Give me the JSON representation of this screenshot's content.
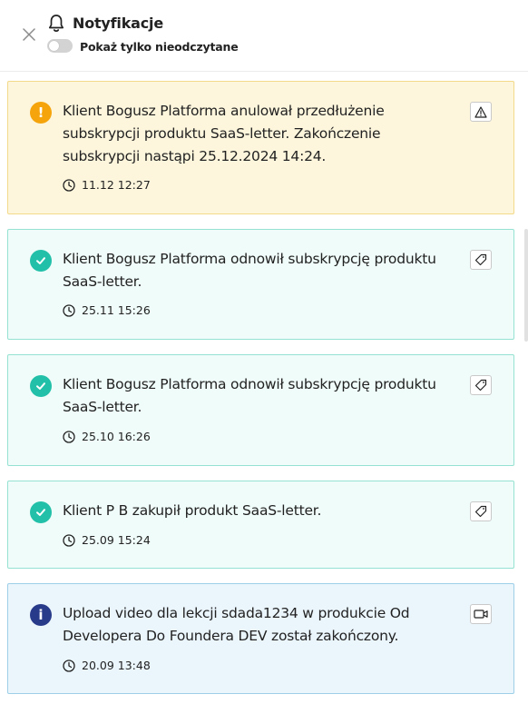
{
  "header": {
    "title": "Notyfikacje",
    "unread_only_label": "Pokaż tylko nieodczytane",
    "unread_only_enabled": false
  },
  "notifications": [
    {
      "kind": "warning",
      "status_icon": "exclamation-icon",
      "status_glyph": "!",
      "type_icon": "warning-triangle-icon",
      "message": "Klient Bogusz Platforma anulował przedłużenie subskrypcji produktu SaaS-letter. Zakończenie subskrypcji nastąpi 25.12.2024 14:24.",
      "time": "11.12 12:27"
    },
    {
      "kind": "success",
      "status_icon": "check-icon",
      "type_icon": "tag-icon",
      "message": "Klient Bogusz Platforma odnowił subskrypcję produktu SaaS-letter.",
      "time": "25.11 15:26"
    },
    {
      "kind": "success",
      "status_icon": "check-icon",
      "type_icon": "tag-icon",
      "message": "Klient Bogusz Platforma odnowił subskrypcję produktu SaaS-letter.",
      "time": "25.10 16:26"
    },
    {
      "kind": "success",
      "status_icon": "check-icon",
      "type_icon": "tag-icon",
      "message": "Klient P B zakupił produkt SaaS-letter.",
      "time": "25.09 15:24"
    },
    {
      "kind": "info",
      "status_icon": "info-icon",
      "status_glyph": "i",
      "type_icon": "video-icon",
      "message": "Upload video dla lekcji sdada1234 w produkcie Od Developera Do Foundera DEV został zakończony.",
      "time": "20.09 13:48"
    }
  ],
  "colors": {
    "warning": "#f5a40c",
    "success": "#22c0a8",
    "info": "#283a8a"
  }
}
